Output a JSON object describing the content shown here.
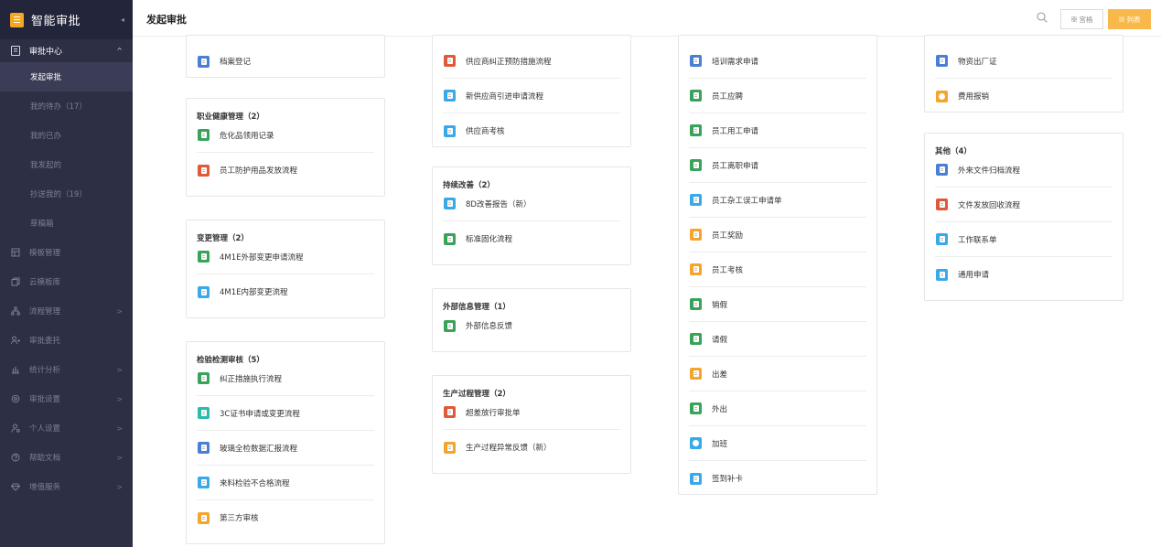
{
  "brand": {
    "title": "智能审批",
    "collapse_icon": "chevron-left-icon"
  },
  "sidebar": {
    "group": {
      "label": "审批中心",
      "caret": "^"
    },
    "subs": [
      {
        "label": "发起审批",
        "active": true
      },
      {
        "label": "我的待办（17）"
      },
      {
        "label": "我的已办"
      },
      {
        "label": "我发起的"
      },
      {
        "label": "抄送我的（19）"
      },
      {
        "label": "草稿箱"
      }
    ],
    "navs": [
      {
        "label": "模板管理",
        "icon": "template-icon",
        "arrow": false
      },
      {
        "label": "云模板库",
        "icon": "cloud-template-icon",
        "arrow": false
      },
      {
        "label": "流程管理",
        "icon": "flow-icon",
        "arrow": true
      },
      {
        "label": "审批委托",
        "icon": "delegate-icon",
        "arrow": false
      },
      {
        "label": "统计分析",
        "icon": "chart-icon",
        "arrow": true
      },
      {
        "label": "审批设置",
        "icon": "settings-icon",
        "arrow": true
      },
      {
        "label": "个人设置",
        "icon": "user-icon",
        "arrow": true
      },
      {
        "label": "帮助文档",
        "icon": "help-icon",
        "arrow": true
      },
      {
        "label": "增值服务",
        "icon": "diamond-icon",
        "arrow": true
      }
    ],
    "arrow_glyph": ">"
  },
  "header": {
    "title": "发起审批",
    "grid_label": "宫格",
    "list_label": "列表",
    "accent": "#f8b84a"
  },
  "colors": {
    "blue": "#4a7fd4",
    "green": "#3aa35a",
    "red": "#e05a3a",
    "sky": "#39a9ea",
    "orange": "#f4a52c",
    "teal": "#2bbbad"
  },
  "cards": [
    {
      "title": "",
      "items": [
        {
          "label": "档案登记",
          "color": "blue"
        }
      ]
    },
    {
      "title": "职业健康管理（2）",
      "items": [
        {
          "label": "危化品领用记录",
          "color": "green"
        },
        {
          "label": "员工防护用品发放流程",
          "color": "red"
        }
      ]
    },
    {
      "title": "变更管理（2）",
      "items": [
        {
          "label": "4M1E外部变更申请流程",
          "color": "green"
        },
        {
          "label": "4M1E内部变更流程",
          "color": "sky"
        }
      ]
    },
    {
      "title": "检验检测审核（5）",
      "items": [
        {
          "label": "纠正措施执行流程",
          "color": "green"
        },
        {
          "label": "3C证书申请或变更流程",
          "color": "teal"
        },
        {
          "label": "玻璃全检数据汇报流程",
          "color": "blue"
        },
        {
          "label": "来料检验不合格流程",
          "color": "sky"
        },
        {
          "label": "第三方审核",
          "color": "orange"
        }
      ]
    },
    {
      "title": "",
      "items": [
        {
          "label": "供应商纠正预防措施流程",
          "color": "red"
        },
        {
          "label": "新供应商引进申请流程",
          "color": "sky"
        },
        {
          "label": "供应商考核",
          "color": "sky"
        }
      ]
    },
    {
      "title": "持续改善（2）",
      "items": [
        {
          "label": "8D改善报告（新）",
          "color": "sky"
        },
        {
          "label": "标准固化流程",
          "color": "green"
        }
      ]
    },
    {
      "title": "外部信息管理（1）",
      "items": [
        {
          "label": "外部信息反馈",
          "color": "green"
        }
      ]
    },
    {
      "title": "生产过程管理（2）",
      "items": [
        {
          "label": "超差放行审批单",
          "color": "red"
        },
        {
          "label": "生产过程异常反馈（新）",
          "color": "orange"
        }
      ]
    },
    {
      "title": "",
      "items": [
        {
          "label": "培训需求申请",
          "color": "blue"
        },
        {
          "label": "员工应聘",
          "color": "green"
        },
        {
          "label": "员工用工申请",
          "color": "green"
        },
        {
          "label": "员工离职申请",
          "color": "green"
        },
        {
          "label": "员工杂工误工申请单",
          "color": "sky"
        },
        {
          "label": "员工奖励",
          "color": "orange"
        },
        {
          "label": "员工考核",
          "color": "orange"
        },
        {
          "label": "销假",
          "color": "green"
        },
        {
          "label": "请假",
          "color": "green"
        },
        {
          "label": "出差",
          "color": "orange"
        },
        {
          "label": "外出",
          "color": "green"
        },
        {
          "label": "加班",
          "color": "sky",
          "round": true
        },
        {
          "label": "签到补卡",
          "color": "sky"
        }
      ]
    },
    {
      "title": "",
      "items": [
        {
          "label": "物资出厂证",
          "color": "blue"
        },
        {
          "label": "费用报销",
          "color": "orange",
          "round": true
        }
      ]
    },
    {
      "title": "其他（4）",
      "items": [
        {
          "label": "外来文件归档流程",
          "color": "blue"
        },
        {
          "label": "文件发放回收流程",
          "color": "red"
        },
        {
          "label": "工作联系单",
          "color": "sky"
        },
        {
          "label": "通用申请",
          "color": "sky"
        }
      ]
    }
  ]
}
